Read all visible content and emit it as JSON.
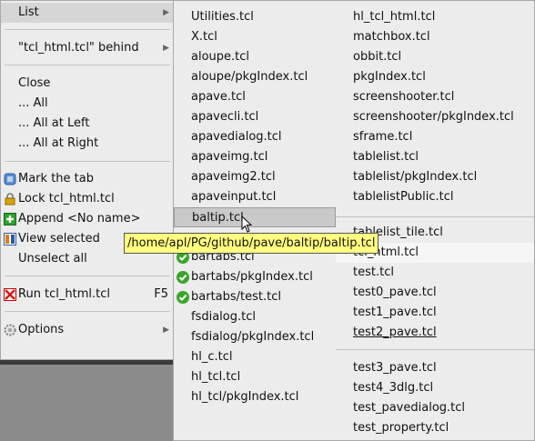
{
  "main_menu": {
    "list": "List",
    "behind": "\"tcl_html.tcl\" behind",
    "close": "Close",
    "all": "... All",
    "all_left": "... All at Left",
    "all_right": "... All at Right",
    "mark": "Mark the tab",
    "lock": "Lock tcl_html.tcl",
    "append": "Append <No name>",
    "view_selected": "View selected",
    "unselect": "Unselect all",
    "run": "Run tcl_html.tcl",
    "run_shortcut": "F5",
    "options": "Options"
  },
  "list_submenu": {
    "col1": [
      "Utilities.tcl",
      "X.tcl",
      "aloupe.tcl",
      "aloupe/pkgIndex.tcl",
      "apave.tcl",
      "apavecli.tcl",
      "apavedialog.tcl",
      "apaveimg.tcl",
      "apaveimg2.tcl",
      "apaveinput.tcl",
      "baltip.tcl",
      "",
      "bartabs.tcl",
      "bartabs/pkgIndex.tcl",
      "bartabs/test.tcl",
      "fsdialog.tcl",
      "fsdialog/pkgIndex.tcl",
      "hl_c.tcl",
      "hl_tcl.tcl",
      "hl_tcl/pkgIndex.tcl"
    ],
    "col2_top": [
      "hl_tcl_html.tcl",
      "matchbox.tcl",
      "obbit.tcl",
      "pkgIndex.tcl",
      "screenshooter.tcl",
      "screenshooter/pkgIndex.tcl",
      "sframe.tcl",
      "tablelist.tcl",
      "tablelist/pkgIndex.tcl",
      "tablelistPublic.tcl"
    ],
    "col2_mid": [
      "tablelist_tile.tcl",
      "tcl_html.tcl",
      "test.tcl",
      "test0_pave.tcl",
      "test1_pave.tcl",
      "test2_pave.tcl"
    ],
    "col2_bot": [
      "test3_pave.tcl",
      "test4_3dlg.tcl",
      "test_pavedialog.tcl",
      "test_property.tcl"
    ]
  },
  "tooltip": "/home/apl/PG/github/pave/baltip/baltip.tcl",
  "colors": {
    "menu_bg": "#ececec",
    "tooltip_bg": "#ffff80",
    "check_green": "#3aa52a"
  }
}
